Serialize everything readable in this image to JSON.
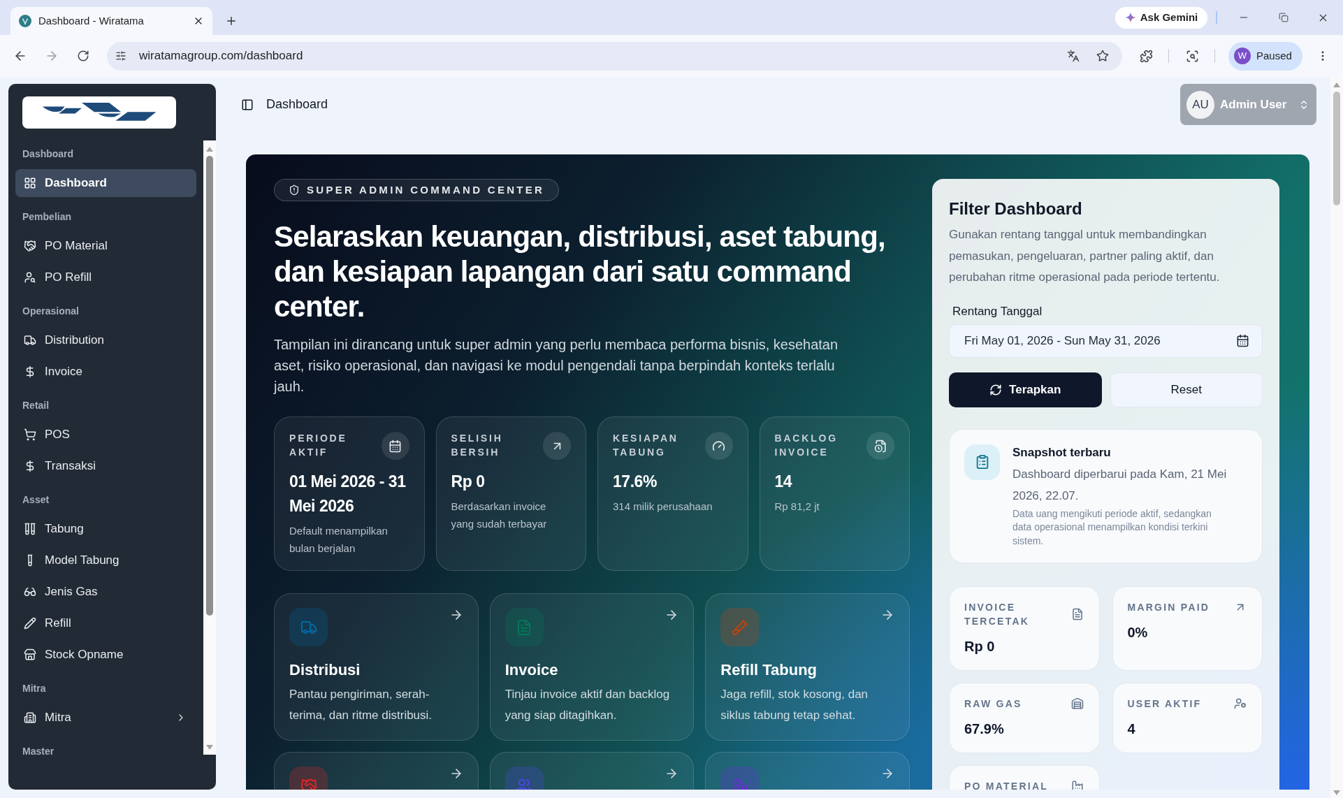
{
  "browser": {
    "tab": {
      "title": "Dashboard - Wiratama",
      "selected": true
    },
    "ask_gemini": "Ask Gemini",
    "url": "wiratamagroup.com/dashboard",
    "profile": {
      "initial": "W",
      "status": "Paused"
    }
  },
  "sidebar": {
    "groups": [
      {
        "title": "Dashboard",
        "items": [
          {
            "label": "Dashboard",
            "kind": "link",
            "selected": true
          }
        ]
      },
      {
        "title": "Pembelian",
        "items": [
          {
            "label": "PO Material",
            "kind": "link",
            "selected": false
          },
          {
            "label": "PO Refill",
            "kind": "link",
            "selected": false
          }
        ]
      },
      {
        "title": "Operasional",
        "items": [
          {
            "label": "Distribution",
            "kind": "link",
            "selected": false
          },
          {
            "label": "Invoice",
            "kind": "link",
            "selected": false
          }
        ]
      },
      {
        "title": "Retail",
        "items": [
          {
            "label": "POS",
            "kind": "link",
            "selected": false
          },
          {
            "label": "Transaksi",
            "kind": "link",
            "selected": false
          }
        ]
      },
      {
        "title": "Asset",
        "items": [
          {
            "label": "Tabung",
            "kind": "link",
            "selected": false
          },
          {
            "label": "Model Tabung",
            "kind": "link",
            "selected": false
          },
          {
            "label": "Jenis Gas",
            "kind": "link",
            "selected": false
          },
          {
            "label": "Refill",
            "kind": "link",
            "selected": false
          },
          {
            "label": "Stock Opname",
            "kind": "link",
            "selected": false
          }
        ]
      },
      {
        "title": "Mitra",
        "items": [
          {
            "label": "Mitra",
            "kind": "group",
            "selected": false,
            "expanded": false
          }
        ]
      },
      {
        "title": "Master"
      }
    ]
  },
  "header": {
    "page_title": "Dashboard",
    "user": {
      "initials": "AU",
      "name": "Admin User"
    }
  },
  "hero": {
    "badge": "SUPER ADMIN COMMAND CENTER",
    "title": "Selaraskan keuangan, distribusi, aset tabung, dan kesiapan lapangan dari satu command center.",
    "description": "Tampilan ini dirancang untuk super admin yang perlu membaca performa bisnis, kesehatan aset, risiko operasional, dan navigasi ke modul pengendali tanpa berpindah konteks terlalu jauh.",
    "stats": [
      {
        "label": "PERIODE AKTIF",
        "value": "01 Mei 2026 - 31 Mei 2026",
        "note": "Default menampilkan bulan berjalan"
      },
      {
        "label": "SELISIH BERSIH",
        "value": "Rp 0",
        "note": "Berdasarkan invoice yang sudah terbayar"
      },
      {
        "label": "KESIAPAN TABUNG",
        "value": "17.6%",
        "note": "314 milik perusahaan"
      },
      {
        "label": "BACKLOG INVOICE",
        "value": "14",
        "note": "Rp 81,2 jt"
      }
    ],
    "modules": [
      {
        "title": "Distribusi",
        "description": "Pantau pengiriman, serah-terima, dan ritme distribusi.",
        "color": "#0369a1"
      },
      {
        "title": "Invoice",
        "description": "Tinjau invoice aktif dan backlog yang siap ditagihkan.",
        "color": "#047857"
      },
      {
        "title": "Refill Tabung",
        "description": "Jaga refill, stok kosong, dan siklus tabung tetap sehat.",
        "color": "#c2410c"
      },
      {
        "color": "#dc2626"
      },
      {
        "color": "#4f46e5"
      },
      {
        "color": "#6d28d9"
      }
    ]
  },
  "filter": {
    "title": "Filter Dashboard",
    "description": "Gunakan rentang tanggal untuk membandingkan pemasukan, pengeluaran, partner paling aktif, dan perubahan ritme operasional pada periode tertentu.",
    "date_label": "Rentang Tanggal",
    "date_value": "Fri May 01, 2026 - Sun May 31, 2026",
    "apply": "Terapkan",
    "reset": "Reset",
    "snapshot": {
      "title": "Snapshot terbaru",
      "text": "Dashboard diperbarui pada Kam, 21 Mei 2026, 22.07.",
      "note": "Data uang mengikuti periode aktif, sedangkan data operasional menampilkan kondisi terkini sistem."
    },
    "metrics": [
      {
        "label": "INVOICE TERCETAK",
        "value": "Rp 0"
      },
      {
        "label": "MARGIN PAID",
        "value": "0%"
      },
      {
        "label": "RAW GAS",
        "value": "67.9%"
      },
      {
        "label": "USER AKTIF",
        "value": "4"
      },
      {
        "label": "PO MATERIAL"
      }
    ]
  }
}
